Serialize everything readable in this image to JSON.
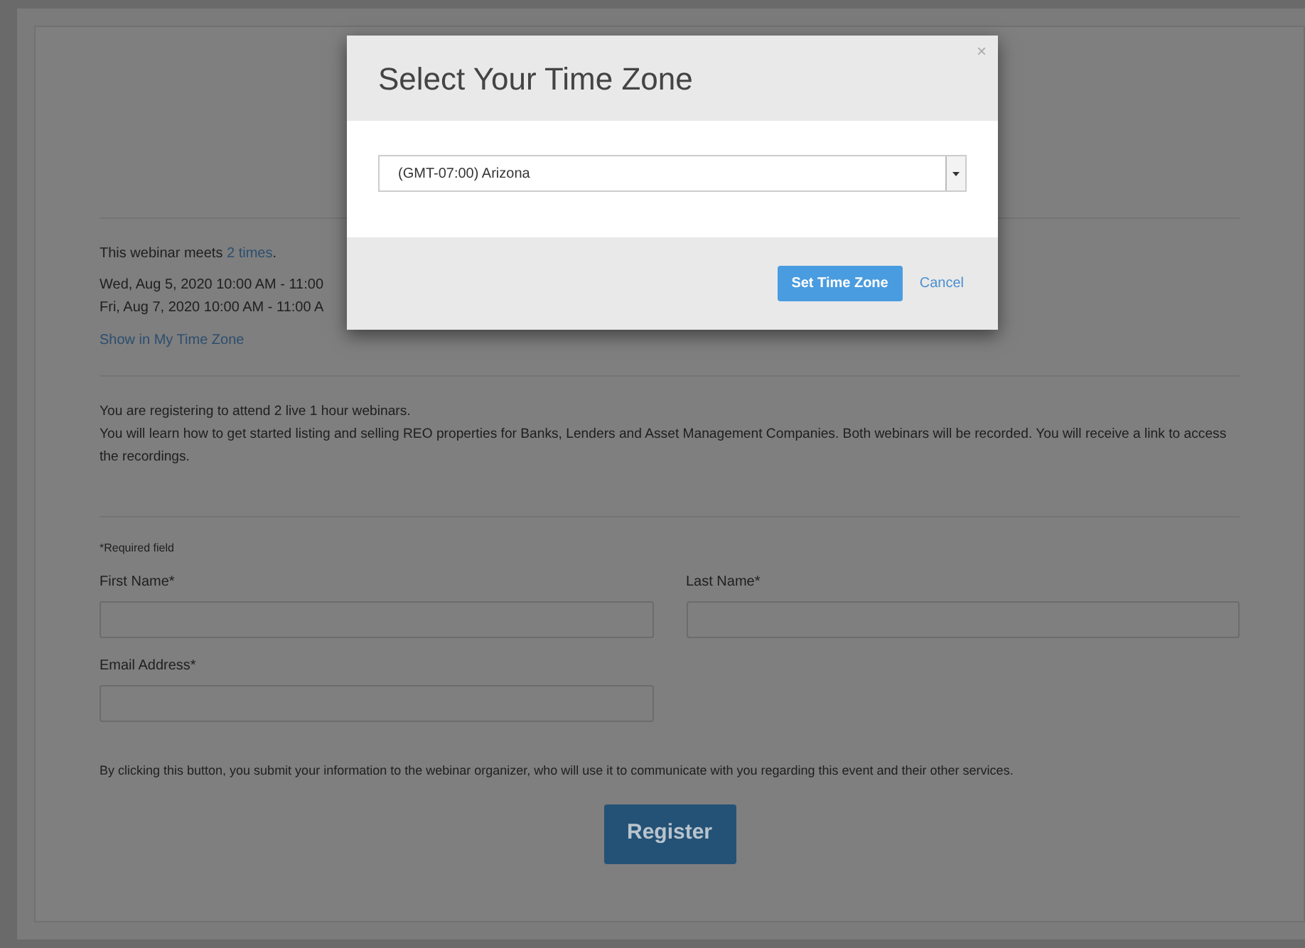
{
  "webinar": {
    "meets_text": "This webinar meets",
    "meets_link": "2 times",
    "meets_end": ".",
    "dates": [
      "Wed, Aug 5, 2020 10:00 AM - 11:00",
      "Fri, Aug 7, 2020 10:00 AM - 11:00 A"
    ],
    "show_link": "Show in My Time Zone"
  },
  "description": [
    "You are registering to attend 2 live 1 hour webinars.",
    "You will learn how to get started listing and selling REO properties for Banks, Lenders and Asset Management Companies.  Both webinars will be recorded.  You will receive a link to access the recordings."
  ],
  "form": {
    "required_note": "*Required field",
    "fields": [
      {
        "label": "First Name*"
      },
      {
        "label": "Last Name*"
      },
      {
        "label": "Email Address*"
      }
    ],
    "consent": "By clicking this button, you submit your information to the webinar organizer, who will use it to communicate with you regarding this event and their other services.",
    "submit": "Register"
  },
  "dialog": {
    "title": "Select Your Time Zone",
    "close": "×",
    "timezone": "(GMT-07:00) Arizona",
    "buttons": [
      {
        "label": "Set Time Zone",
        "kind": "primary"
      },
      {
        "label": "Cancel",
        "kind": "link"
      }
    ]
  }
}
